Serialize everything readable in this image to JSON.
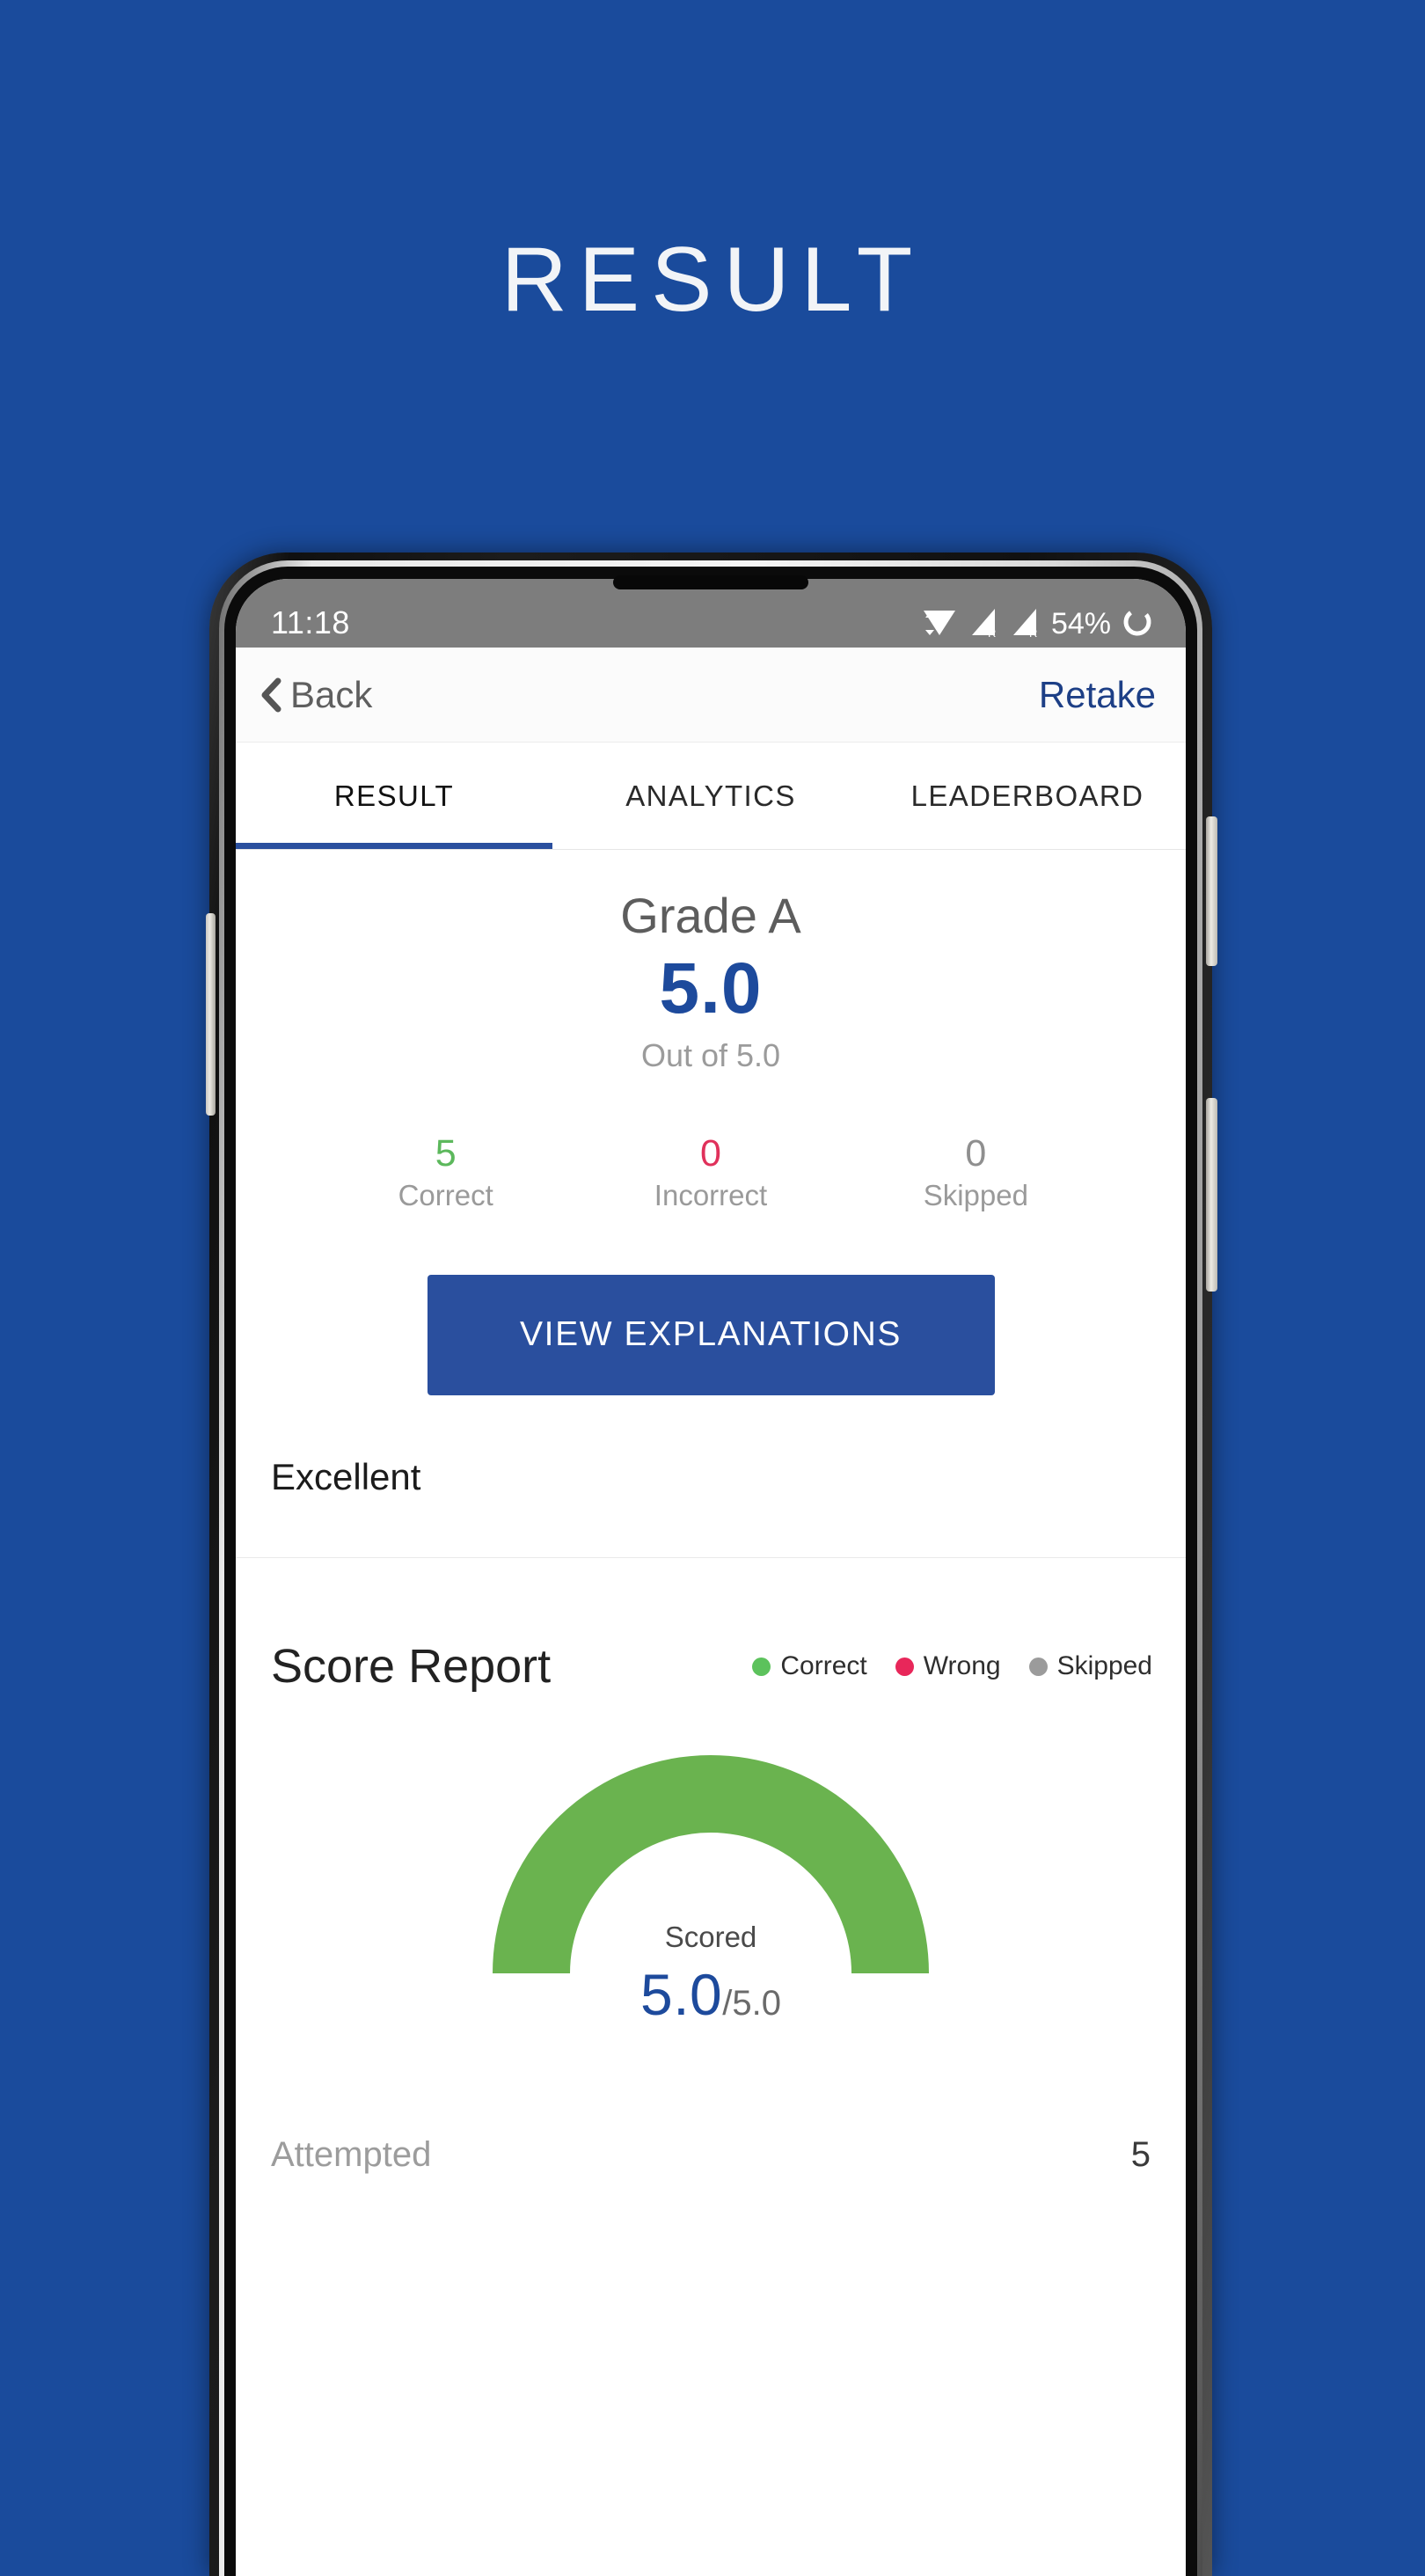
{
  "page": {
    "title": "RESULT",
    "background_color": "#1A4B9C"
  },
  "status_bar": {
    "time": "11:18",
    "battery_percent": "54%",
    "icons": [
      "wifi-icon",
      "signal-roaming-icon",
      "signal-roaming-icon-2",
      "battery-circle-icon"
    ]
  },
  "navbar": {
    "back_label": "Back",
    "retake_label": "Retake"
  },
  "tabs": {
    "items": [
      {
        "label": "RESULT",
        "active": true
      },
      {
        "label": "ANALYTICS",
        "active": false
      },
      {
        "label": "LEADERBOARD",
        "active": false
      }
    ],
    "active_index": 0,
    "indicator_color": "#2a4f9e"
  },
  "result": {
    "grade": "Grade A",
    "score": "5.0",
    "out_of": "Out of 5.0",
    "score_color": "#1d4a9c",
    "stats": [
      {
        "value": "5",
        "label": "Correct",
        "color": "#5cb85c"
      },
      {
        "value": "0",
        "label": "Incorrect",
        "color": "#e0315b"
      },
      {
        "value": "0",
        "label": "Skipped",
        "color": "#8f8f8f"
      }
    ],
    "view_explanations_label": "VIEW EXPLANATIONS",
    "remark": "Excellent"
  },
  "score_report": {
    "title": "Score Report",
    "legend": [
      {
        "label": "Correct",
        "color": "#5cc25c"
      },
      {
        "label": "Wrong",
        "color": "#e8275a"
      },
      {
        "label": "Skipped",
        "color": "#9b9b9b"
      }
    ],
    "gauge": {
      "center_label": "Scored",
      "value": "5.0",
      "denominator": "/5.0",
      "arc_color": "#6ab34f",
      "track_color": "#ececec",
      "percent": 100
    },
    "rows": [
      {
        "label": "Attempted",
        "value": "5"
      }
    ]
  },
  "chart_data": {
    "type": "pie",
    "title": "Score Report",
    "subtitle": "Scored 5.0 / 5.0",
    "categories": [
      "Correct",
      "Wrong",
      "Skipped"
    ],
    "values": [
      5,
      0,
      0
    ],
    "colors": [
      "#5cc25c",
      "#e8275a",
      "#9b9b9b"
    ],
    "legend_position": "top-right",
    "gauge_max": 5.0,
    "gauge_value": 5.0,
    "gauge_percent": 100,
    "annotations": [
      "Grade A",
      "Out of 5.0",
      "Excellent",
      "Attempted: 5"
    ]
  }
}
